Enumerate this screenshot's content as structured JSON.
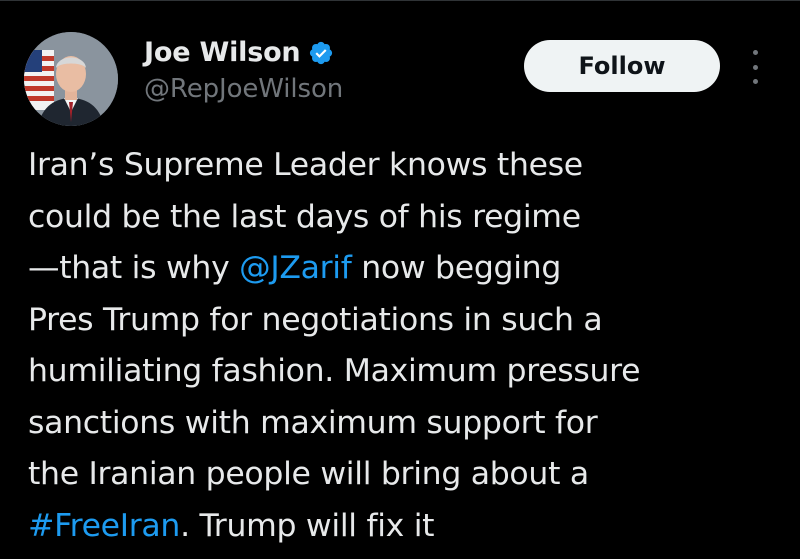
{
  "author": {
    "display_name": "Joe Wilson",
    "handle": "@RepJoeWilson",
    "verified": true
  },
  "follow_button": {
    "label": "Follow"
  },
  "tweet": {
    "lines": [
      [
        "Iran’s Supreme Leader knows these"
      ],
      [
        "could be the last days of his regime"
      ],
      [
        "—that is why ",
        "@JZarif",
        " now begging"
      ],
      [
        "Pres Trump for negotiations in such a"
      ],
      [
        "humiliating fashion. Maximum pressure"
      ],
      [
        "sanctions with maximum support for"
      ],
      [
        "the Iranian people will bring about a"
      ],
      [
        "#FreeIran",
        ". Trump will fix it"
      ]
    ],
    "mention": "@JZarif",
    "hashtag": "#FreeIran"
  },
  "colors": {
    "background": "#000000",
    "text": "#e7e9ea",
    "secondary": "#71767b",
    "link": "#1d9bf0",
    "verified": "#1d9bf0",
    "button_bg": "#eff3f4"
  },
  "icons": {
    "verified": "verified-badge-icon",
    "more": "more-options-icon"
  }
}
